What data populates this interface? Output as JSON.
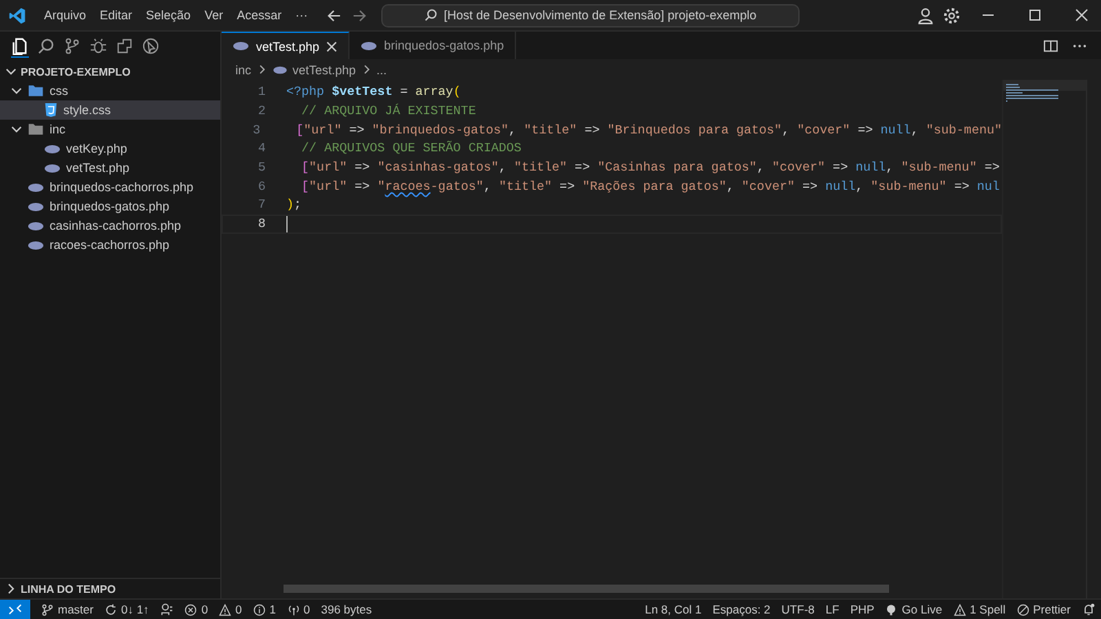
{
  "window": {
    "menu": [
      "Arquivo",
      "Editar",
      "Seleção",
      "Ver",
      "Acessar",
      "···"
    ],
    "command_center": "[Host de Desenvolvimento de Extensão] projeto-exemplo"
  },
  "activity_bar": [
    {
      "kind": "files",
      "selected": true
    },
    {
      "kind": "search",
      "selected": false
    },
    {
      "kind": "source-control",
      "selected": false
    },
    {
      "kind": "debug",
      "selected": false
    },
    {
      "kind": "extensions",
      "selected": false
    },
    {
      "kind": "remote",
      "selected": false
    }
  ],
  "explorer": {
    "title": "PROJETO-EXEMPLO",
    "expanded": true,
    "tree": [
      {
        "label": "css",
        "kind": "folder",
        "expanded": true,
        "selected": false,
        "children": [
          {
            "label": "style.css",
            "kind": "css",
            "selected": true
          }
        ]
      },
      {
        "label": "inc",
        "kind": "folder",
        "expanded": true,
        "selected": false,
        "children": [
          {
            "label": "vetKey.php",
            "kind": "php",
            "selected": false
          },
          {
            "label": "vetTest.php",
            "kind": "php",
            "selected": false
          }
        ]
      },
      {
        "label": "brinquedos-cachorros.php",
        "kind": "php",
        "selected": false
      },
      {
        "label": "brinquedos-gatos.php",
        "kind": "php",
        "selected": false
      },
      {
        "label": "casinhas-cachorros.php",
        "kind": "php",
        "selected": false
      },
      {
        "label": "racoes-cachorros.php",
        "kind": "php",
        "selected": false
      }
    ]
  },
  "timeline": {
    "title": "LINHA DO TEMPO",
    "expanded": false
  },
  "tabs": [
    {
      "label": "vetTest.php",
      "selected": true
    },
    {
      "label": "brinquedos-gatos.php",
      "selected": false
    }
  ],
  "breadcrumb": [
    "inc",
    "vetTest.php",
    "..."
  ],
  "editor": {
    "lines": [
      {
        "number": "1",
        "current": false,
        "tokens": [
          {
            "t": "<?php ",
            "kind": "tag"
          },
          {
            "t": "$vetTest",
            "kind": "var"
          },
          {
            "t": " = ",
            "kind": "op"
          },
          {
            "t": "array",
            "kind": "fn"
          },
          {
            "t": "(",
            "kind": "brace1"
          }
        ]
      },
      {
        "number": "2",
        "current": false,
        "tokens": [
          {
            "t": "  // ARQUIVO JÁ EXISTENTE",
            "kind": "comment"
          }
        ]
      },
      {
        "number": "3",
        "current": false,
        "tokens": [
          {
            "t": "  [",
            "kind": "brace2"
          },
          {
            "t": "\"url\"",
            "kind": "str"
          },
          {
            "t": " => ",
            "kind": "op"
          },
          {
            "t": "\"brinquedos-gatos\"",
            "kind": "str"
          },
          {
            "t": ", ",
            "kind": "op"
          },
          {
            "t": "\"title\"",
            "kind": "str"
          },
          {
            "t": " => ",
            "kind": "op"
          },
          {
            "t": "\"Brinquedos para gatos\"",
            "kind": "str"
          },
          {
            "t": ", ",
            "kind": "op"
          },
          {
            "t": "\"cover\"",
            "kind": "str"
          },
          {
            "t": " => ",
            "kind": "op"
          },
          {
            "t": "null",
            "kind": "kw"
          },
          {
            "t": ", ",
            "kind": "op"
          },
          {
            "t": "\"sub-menu\"",
            "kind": "str"
          }
        ]
      },
      {
        "number": "4",
        "current": false,
        "tokens": [
          {
            "t": "  // ARQUIVOS QUE SERÃO CRIADOS",
            "kind": "comment"
          }
        ]
      },
      {
        "number": "5",
        "current": false,
        "tokens": [
          {
            "t": "  [",
            "kind": "brace2"
          },
          {
            "t": "\"url\"",
            "kind": "str"
          },
          {
            "t": " => ",
            "kind": "op"
          },
          {
            "t": "\"casinhas-gatos\"",
            "kind": "str"
          },
          {
            "t": ", ",
            "kind": "op"
          },
          {
            "t": "\"title\"",
            "kind": "str"
          },
          {
            "t": " => ",
            "kind": "op"
          },
          {
            "t": "\"Casinhas para gatos\"",
            "kind": "str"
          },
          {
            "t": ", ",
            "kind": "op"
          },
          {
            "t": "\"cover\"",
            "kind": "str"
          },
          {
            "t": " => ",
            "kind": "op"
          },
          {
            "t": "null",
            "kind": "kw"
          },
          {
            "t": ", ",
            "kind": "op"
          },
          {
            "t": "\"sub-menu\"",
            "kind": "str"
          },
          {
            "t": " =>",
            "kind": "op"
          }
        ]
      },
      {
        "number": "6",
        "current": false,
        "tokens": [
          {
            "t": "  [",
            "kind": "brace2"
          },
          {
            "t": "\"url\"",
            "kind": "str"
          },
          {
            "t": " => ",
            "kind": "op"
          },
          {
            "t": "\"",
            "kind": "str"
          },
          {
            "t": "racoes",
            "kind": "str-spell"
          },
          {
            "t": "-gatos\"",
            "kind": "str"
          },
          {
            "t": ", ",
            "kind": "op"
          },
          {
            "t": "\"title\"",
            "kind": "str"
          },
          {
            "t": " => ",
            "kind": "op"
          },
          {
            "t": "\"Rações para gatos\"",
            "kind": "str"
          },
          {
            "t": ", ",
            "kind": "op"
          },
          {
            "t": "\"cover\"",
            "kind": "str"
          },
          {
            "t": " => ",
            "kind": "op"
          },
          {
            "t": "null",
            "kind": "kw"
          },
          {
            "t": ", ",
            "kind": "op"
          },
          {
            "t": "\"sub-menu\"",
            "kind": "str"
          },
          {
            "t": " => ",
            "kind": "op"
          },
          {
            "t": "nul",
            "kind": "kw"
          }
        ]
      },
      {
        "number": "7",
        "current": false,
        "tokens": [
          {
            "t": ")",
            "kind": "brace1"
          },
          {
            "t": ";",
            "kind": "op"
          }
        ]
      },
      {
        "number": "8",
        "current": true
      }
    ]
  },
  "status_bar": {
    "left": [
      {
        "kind": "remote"
      },
      {
        "kind": "branch",
        "text": "master"
      },
      {
        "kind": "sync",
        "text": "0↓ 1↑"
      },
      {
        "kind": "tool"
      },
      {
        "kind": "error",
        "text": "0"
      },
      {
        "kind": "warning",
        "text": "0"
      },
      {
        "kind": "info",
        "text": "1"
      },
      {
        "kind": "ports",
        "text": "0"
      },
      {
        "kind": "plain",
        "text": "396 bytes"
      }
    ],
    "right": [
      {
        "kind": "plain",
        "text": "Ln 8, Col 1"
      },
      {
        "kind": "plain",
        "text": "Espaços: 2"
      },
      {
        "kind": "plain",
        "text": "UTF-8"
      },
      {
        "kind": "plain",
        "text": "LF"
      },
      {
        "kind": "plain",
        "text": "PHP"
      },
      {
        "kind": "live",
        "text": "Go Live"
      },
      {
        "kind": "warning",
        "text": "1 Spell"
      },
      {
        "kind": "prettier",
        "text": "Prettier"
      },
      {
        "kind": "bell"
      }
    ]
  }
}
